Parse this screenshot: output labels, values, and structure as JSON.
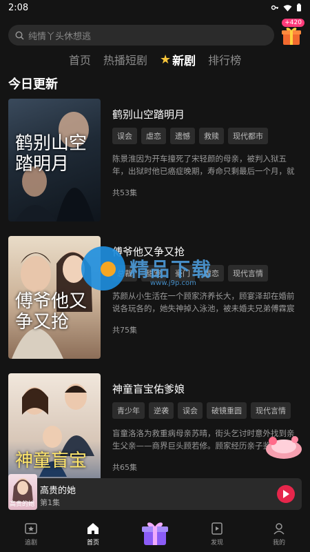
{
  "status_bar": {
    "time": "2:08"
  },
  "search": {
    "placeholder": "纯情丫头休想逃"
  },
  "gift": {
    "badge": "+420"
  },
  "tabs": [
    {
      "label": "首页"
    },
    {
      "label": "热播短剧"
    },
    {
      "label": "新剧",
      "active": true
    },
    {
      "label": "排行榜"
    }
  ],
  "section": {
    "title": "今日更新"
  },
  "dramas": [
    {
      "title": "鹤别山空踏明月",
      "poster_text": "鹤别山空踏明月",
      "tags": [
        "误会",
        "虐恋",
        "遗憾",
        "救赎",
        "现代都市"
      ],
      "description": "陈景淮因为开车撞死了宋轻颜的母亲，被判入狱五年，出狱时他已癌症晚期，寿命只剩最后一个月，就在这最后一个月里…",
      "episodes": "共53集"
    },
    {
      "title": "傅爷他又争又抢",
      "poster_text": "傅爷他又争又抢",
      "tags": [
        "总裁",
        "甜宠",
        "豪门",
        "虐恋",
        "现代言情"
      ],
      "description": "苏颜从小生活在一个顾家济养长大，顾宴泽却在婚前说各玩各的，她失神掉入泳池，被未婚夫兄弟傅霖宸救下。傅霖…",
      "episodes": "共75集"
    },
    {
      "title": "神童盲宝佑爹娘",
      "poster_text": "神童盲宝",
      "tags": [
        "青少年",
        "逆袭",
        "误会",
        "破镜重圆",
        "现代言情"
      ],
      "description": "盲童洛洛为救重病母亲苏晴，街头乞讨时意外找到亲生父亲——商界巨头顾若修。顾家经历亲子鉴定风波后接纳…",
      "episodes": "共65集"
    }
  ],
  "watermark": {
    "text": "精品下载",
    "url": "www.j9p.com"
  },
  "mini_player": {
    "title": "高贵的她",
    "episode": "第1集",
    "cover_text": "高贵的她"
  },
  "nav": [
    {
      "label": "追剧",
      "icon": "star-folder-icon"
    },
    {
      "label": "首页",
      "icon": "home-icon",
      "active": true
    },
    {
      "label": "",
      "icon": "gift-box-icon"
    },
    {
      "label": "发现",
      "icon": "discover-icon"
    },
    {
      "label": "我的",
      "icon": "profile-icon"
    }
  ],
  "colors": {
    "accent": "#e6264b",
    "background": "#141414",
    "star": "#f7c53a"
  }
}
